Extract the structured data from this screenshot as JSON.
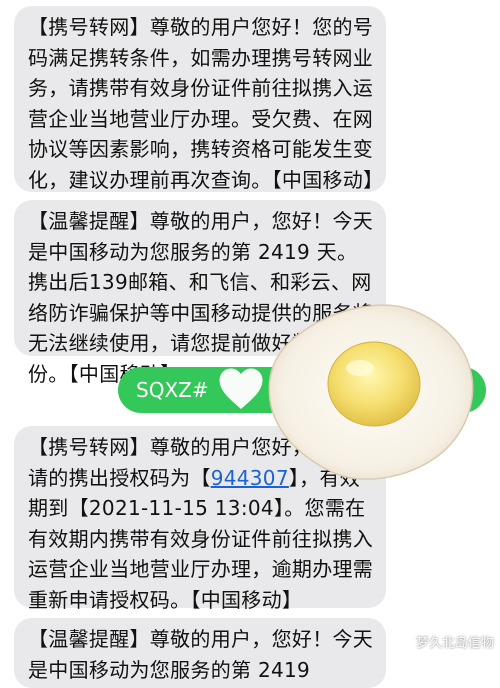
{
  "messages": {
    "m1": "【携号转网】尊敬的用户您好！您的号码满足携转条件，如需办理携号转网业务，请携带有效身份证件前往拟携入运营企业当地营业厅办理。受欠费、在网协议等因素影响，携转资格可能发生变化，建议办理前再次查询。【中国移动】",
    "m2": "【温馨提醒】尊敬的用户，您好！今天是中国移动为您服务的第 2419 天。携出后139邮箱、和飞信、和彩云、网络防诈骗保护等中国移动提供的服务将无法继续使用，请您提前做好数据备份。【中国移动】",
    "m3_before": "【携号转网】尊敬的用户您好，您本次请的携出授权码为【",
    "m3_code": "944307",
    "m3_after": "】，有效期到【2021-11-15 13:04】。您需在有效期内携带有效身份证件前往拟携入运营企业当地营业厅办理，逾期办理需重新申请授权码。【中国移动】",
    "m4": "【温馨提醒】尊敬的用户，您好！今天是中国移动为您服务的第 2419"
  },
  "outgoing": {
    "text": "SQXZ#"
  },
  "watermark": "梦久北岛信物",
  "colors": {
    "incoming_bubble": "#e9e9eb",
    "outgoing_bubble": "#34c759",
    "link": "#1a63d6"
  },
  "icons": {
    "sticker": "fried-egg-sticker",
    "heart": "heart-doodle-icon"
  }
}
